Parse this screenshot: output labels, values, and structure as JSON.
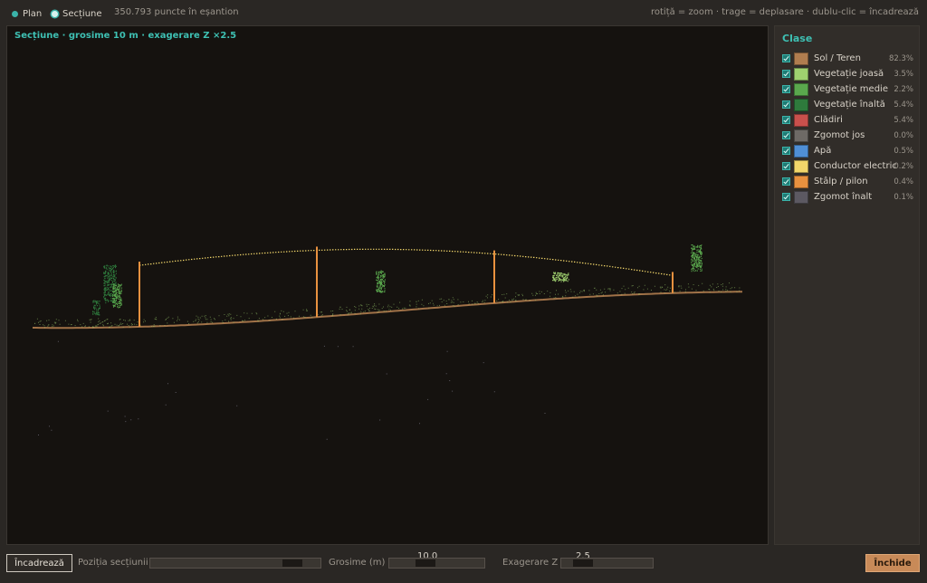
{
  "topbar": {
    "mode_plan": "Plan",
    "mode_section": "Secțiune",
    "point_count": "350.793 puncte în eșantion",
    "hint": "rotiță = zoom · trage = deplasare · dublu-clic = încadrează"
  },
  "viewport": {
    "title": "Secțiune · grosime 10 m · exagerare Z ×2.5"
  },
  "panel": {
    "title": "Clase",
    "classes": [
      {
        "name": "Sol / Teren",
        "pct": "82.3%",
        "color": "#b07d4f",
        "checked": true
      },
      {
        "name": "Vegetație joasă",
        "pct": "3.5%",
        "color": "#9fd06f",
        "checked": true
      },
      {
        "name": "Vegetație medie",
        "pct": "2.2%",
        "color": "#5aa84d",
        "checked": true
      },
      {
        "name": "Vegetație înaltă",
        "pct": "5.4%",
        "color": "#2e7a3c",
        "checked": true
      },
      {
        "name": "Clădiri",
        "pct": "5.4%",
        "color": "#c9504c",
        "checked": true
      },
      {
        "name": "Zgomot jos",
        "pct": "0.0%",
        "color": "#6e6a66",
        "checked": true
      },
      {
        "name": "Apă",
        "pct": "0.5%",
        "color": "#4f8fd6",
        "checked": true
      },
      {
        "name": "Conductor electric",
        "pct": "0.2%",
        "color": "#f2d66a",
        "checked": true
      },
      {
        "name": "Stâlp / pilon",
        "pct": "0.4%",
        "color": "#e8913f",
        "checked": true
      },
      {
        "name": "Zgomot înalt",
        "pct": "0.1%",
        "color": "#5c5962",
        "checked": true
      }
    ]
  },
  "bottombar": {
    "fit_button": "Încadrează",
    "position_label": "Poziția secțiunii",
    "position_value": 0.88,
    "thickness_label": "Grosime (m)",
    "thickness_value": "10.0",
    "exaggeration_label": "Exagerare Z",
    "exaggeration_value": "2.5",
    "close_button": "Închide"
  }
}
